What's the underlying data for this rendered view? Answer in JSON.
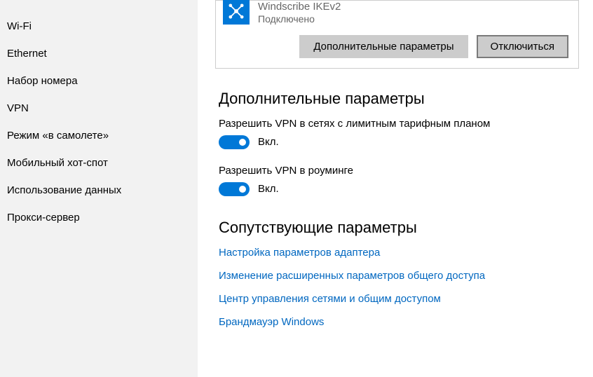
{
  "sidebar": {
    "items": [
      {
        "label": "Wi-Fi"
      },
      {
        "label": "Ethernet"
      },
      {
        "label": "Набор номера"
      },
      {
        "label": "VPN"
      },
      {
        "label": "Режим «в самолете»"
      },
      {
        "label": "Мобильный хот-спот"
      },
      {
        "label": "Использование данных"
      },
      {
        "label": "Прокси-сервер"
      }
    ]
  },
  "vpn_panel": {
    "connection_name": "Windscribe IKEv2",
    "status": "Подключено",
    "advanced_button": "Дополнительные параметры",
    "disconnect_button": "Отключиться"
  },
  "advanced": {
    "heading": "Дополнительные параметры",
    "metered_label": "Разрешить VPN в сетях с лимитным тарифным планом",
    "metered_value": "Вкл.",
    "roaming_label": "Разрешить VPN в роуминге",
    "roaming_value": "Вкл."
  },
  "related": {
    "heading": "Сопутствующие параметры",
    "links": [
      "Настройка параметров адаптера",
      "Изменение расширенных параметров общего доступа",
      "Центр управления сетями и общим доступом",
      "Брандмауэр Windows"
    ]
  }
}
